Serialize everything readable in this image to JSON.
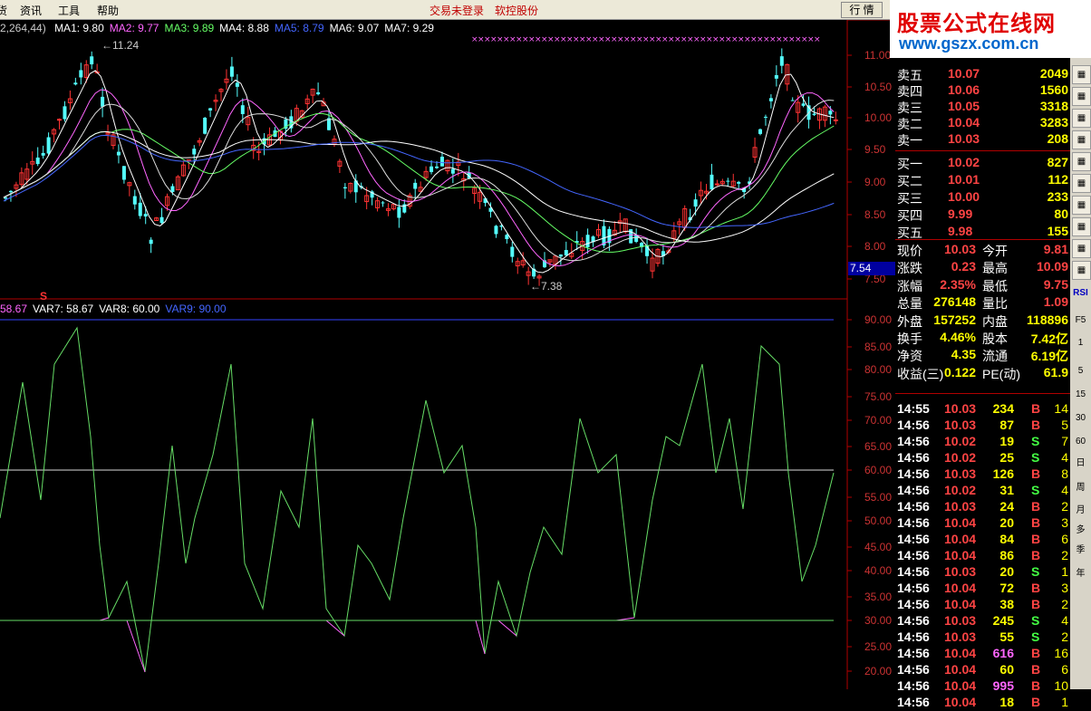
{
  "menu": {
    "items": [
      "货",
      "资讯",
      "工具",
      "帮助"
    ],
    "status1": "交易未登录",
    "status2": "软控股份",
    "hq_button": "行 情"
  },
  "logo": {
    "line1": "股票公式在线网",
    "line2": "www.gszx.com.cn"
  },
  "ma_legend": {
    "prefix": "2,264,44)",
    "items": [
      {
        "label": "MA1: 9.80",
        "color": "#ffffff"
      },
      {
        "label": "MA2: 9.77",
        "color": "#ff66ff"
      },
      {
        "label": "MA3: 9.89",
        "color": "#66ff66"
      },
      {
        "label": "MA4: 8.88",
        "color": "#ffffff"
      },
      {
        "label": "MA5: 8.79",
        "color": "#4466ff"
      },
      {
        "label": "MA6: 9.07",
        "color": "#ffffff"
      },
      {
        "label": "MA7: 9.29",
        "color": "#ffffff"
      }
    ]
  },
  "var_legend": {
    "items": [
      {
        "label": "58.67",
        "color": "#ff66ff"
      },
      {
        "label": "VAR7: 58.67",
        "color": "#ffffff"
      },
      {
        "label": "VAR8: 60.00",
        "color": "#ffffff"
      },
      {
        "label": "VAR9: 90.00",
        "color": "#4466ff"
      }
    ]
  },
  "annotations": {
    "high": "11.24",
    "low": "7.38",
    "marker": "S",
    "current_price_tag": "7.54"
  },
  "price_axis": [
    "11.00",
    "10.50",
    "10.00",
    "9.50",
    "9.00",
    "8.50",
    "8.00",
    "7.50"
  ],
  "osc_axis": [
    "90.00",
    "85.00",
    "80.00",
    "75.00",
    "70.00",
    "65.00",
    "60.00",
    "55.00",
    "50.00",
    "45.00",
    "40.00",
    "35.00",
    "30.00",
    "25.00",
    "20.00"
  ],
  "quote": {
    "sell": [
      {
        "label": "卖五",
        "price": "10.07",
        "vol": "2049"
      },
      {
        "label": "卖四",
        "price": "10.06",
        "vol": "1560"
      },
      {
        "label": "卖三",
        "price": "10.05",
        "vol": "3318"
      },
      {
        "label": "卖二",
        "price": "10.04",
        "vol": "3283"
      },
      {
        "label": "卖一",
        "price": "10.03",
        "vol": "208"
      }
    ],
    "buy": [
      {
        "label": "买一",
        "price": "10.02",
        "vol": "827"
      },
      {
        "label": "买二",
        "price": "10.01",
        "vol": "112"
      },
      {
        "label": "买三",
        "price": "10.00",
        "vol": "233"
      },
      {
        "label": "买四",
        "price": "9.99",
        "vol": "80"
      },
      {
        "label": "买五",
        "price": "9.98",
        "vol": "155"
      }
    ],
    "stats": [
      {
        "k1": "现价",
        "v1": "10.03",
        "k2": "今开",
        "v2": "9.81"
      },
      {
        "k1": "涨跌",
        "v1": "0.23",
        "k2": "最高",
        "v2": "10.09"
      },
      {
        "k1": "涨幅",
        "v1": "2.35%",
        "k2": "最低",
        "v2": "9.75"
      },
      {
        "k1": "总量",
        "v1": "276148",
        "k2": "量比",
        "v2": "1.09"
      },
      {
        "k1": "外盘",
        "v1": "157252",
        "k2": "内盘",
        "v2": "118896"
      },
      {
        "k1": "换手",
        "v1": "4.46%",
        "k2": "股本",
        "v2": "7.42亿"
      },
      {
        "k1": "净资",
        "v1": "4.35",
        "k2": "流通",
        "v2": "6.19亿"
      },
      {
        "k1": "收益(三)",
        "v1": "0.122",
        "k2": "PE(动)",
        "v2": "61.9"
      }
    ],
    "ticks": [
      [
        "14:55",
        "10.03",
        "234",
        "B",
        "14"
      ],
      [
        "14:56",
        "10.03",
        "87",
        "B",
        "5"
      ],
      [
        "14:56",
        "10.02",
        "19",
        "S",
        "7"
      ],
      [
        "14:56",
        "10.02",
        "25",
        "S",
        "4"
      ],
      [
        "14:56",
        "10.03",
        "126",
        "B",
        "8"
      ],
      [
        "14:56",
        "10.02",
        "31",
        "S",
        "4"
      ],
      [
        "14:56",
        "10.03",
        "24",
        "B",
        "2"
      ],
      [
        "14:56",
        "10.04",
        "20",
        "B",
        "3"
      ],
      [
        "14:56",
        "10.04",
        "84",
        "B",
        "6"
      ],
      [
        "14:56",
        "10.04",
        "86",
        "B",
        "2"
      ],
      [
        "14:56",
        "10.03",
        "20",
        "S",
        "1"
      ],
      [
        "14:56",
        "10.04",
        "72",
        "B",
        "3"
      ],
      [
        "14:56",
        "10.04",
        "38",
        "B",
        "2"
      ],
      [
        "14:56",
        "10.03",
        "245",
        "S",
        "4"
      ],
      [
        "14:56",
        "10.03",
        "55",
        "S",
        "2"
      ],
      [
        "14:56",
        "10.04",
        "616",
        "B",
        "16"
      ],
      [
        "14:56",
        "10.04",
        "60",
        "B",
        "6"
      ],
      [
        "14:56",
        "10.04",
        "995",
        "B",
        "10"
      ],
      [
        "14:56",
        "10.04",
        "18",
        "B",
        "1"
      ]
    ]
  },
  "toolbar": [
    "RSI",
    "F5",
    "1",
    "5",
    "15",
    "30",
    "60",
    "日",
    "周",
    "月",
    "多",
    "季",
    "年"
  ],
  "colors": {
    "up": "#ff3333",
    "down": "#54ffff",
    "axis": "#b00000",
    "label": "#ffff00"
  }
}
